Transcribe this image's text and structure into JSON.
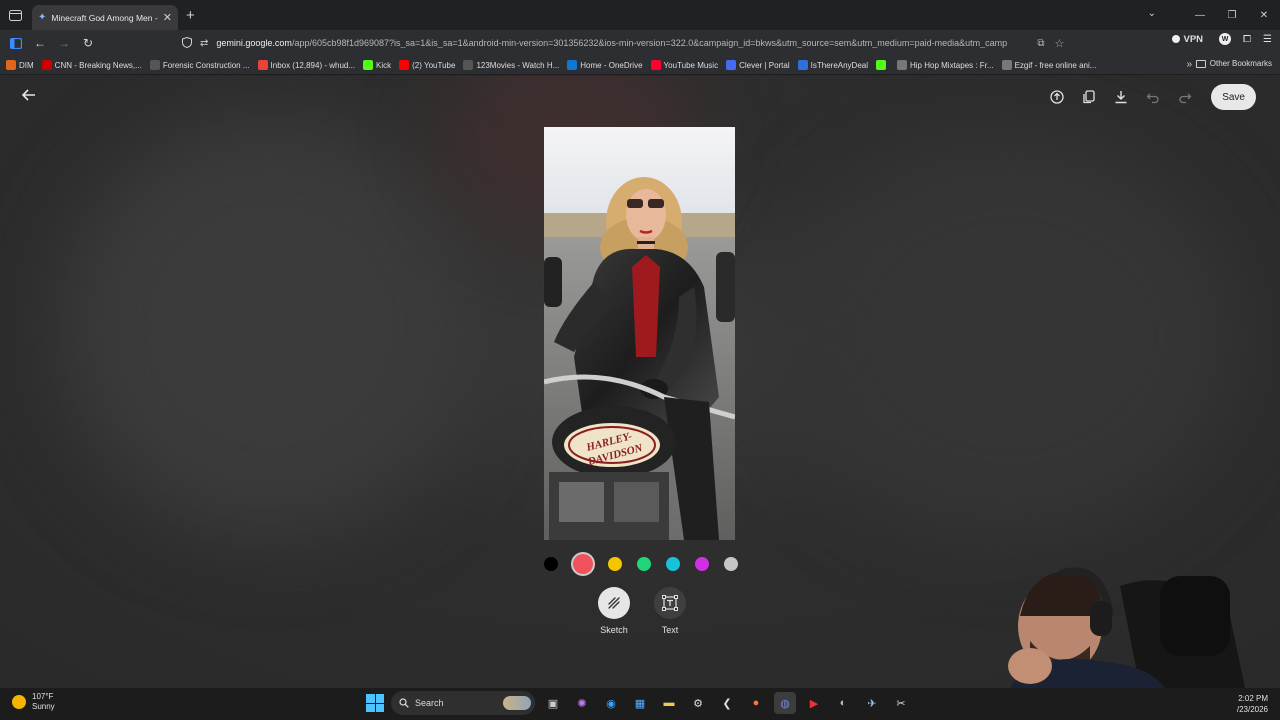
{
  "browser": {
    "tab_title": "Minecraft God Among Men - G",
    "url_host": "gemini.google.com",
    "url_path": "/app/605cb98f1d969087?is_sa=1&is_sa=1&android-min-version=301356232&ios-min-version=322.0&campaign_id=bkws&utm_source=sem&utm_medium=paid-media&utm_camp",
    "url_prefix": "",
    "vpn_label": "VPN",
    "bookmarks": [
      {
        "label": "DIM",
        "icon": "dim-icon",
        "color": "#e0661c"
      },
      {
        "label": "CNN - Breaking News,...",
        "icon": "cnn-icon",
        "color": "#cc0000"
      },
      {
        "label": "Forensic Construction ...",
        "icon": "globe-icon",
        "color": "#555555"
      },
      {
        "label": "Inbox (12,894) - whud...",
        "icon": "gmail-icon",
        "color": "#ea4335"
      },
      {
        "label": "Kick",
        "icon": "kick-icon",
        "color": "#53fc18"
      },
      {
        "label": "(2) YouTube",
        "icon": "youtube-icon",
        "color": "#ff0000"
      },
      {
        "label": "123Movies - Watch H...",
        "icon": "globe-icon",
        "color": "#555555"
      },
      {
        "label": "Home - OneDrive",
        "icon": "onedrive-icon",
        "color": "#0f78d4"
      },
      {
        "label": "YouTube Music",
        "icon": "youtube-music-icon",
        "color": "#ff0033"
      },
      {
        "label": "Clever | Portal",
        "icon": "clever-icon",
        "color": "#436cf2"
      },
      {
        "label": "IsThereAnyDeal",
        "icon": "itad-icon",
        "color": "#2f6fdc"
      },
      {
        "label": "",
        "icon": "kick-icon",
        "color": "#53fc18"
      },
      {
        "label": "Hip Hop Mixtapes : Fr...",
        "icon": "page-icon",
        "color": "#777777"
      },
      {
        "label": "Ezgif - free online ani...",
        "icon": "ezgif-icon",
        "color": "#777777"
      }
    ],
    "other_bookmarks": "Other Bookmarks"
  },
  "editor": {
    "save_label": "Save",
    "colors": [
      "#000000",
      "#f0525d",
      "#f7c400",
      "#1fd67a",
      "#17c3d9",
      "#d22fe5",
      "#c6c6c6"
    ],
    "selected_color_index": 1,
    "tools": [
      {
        "label": "Sketch",
        "icon": "sketch-icon",
        "active": true
      },
      {
        "label": "Text",
        "icon": "text-box-icon",
        "active": false
      }
    ]
  },
  "photo": {
    "tank_text_1": "HARLEY-",
    "tank_text_2": "DAVIDSON"
  },
  "taskbar": {
    "temp": "107°F",
    "condition": "Sunny",
    "search_label": "Search",
    "time": "2:02 PM",
    "date": "/23/2026"
  }
}
